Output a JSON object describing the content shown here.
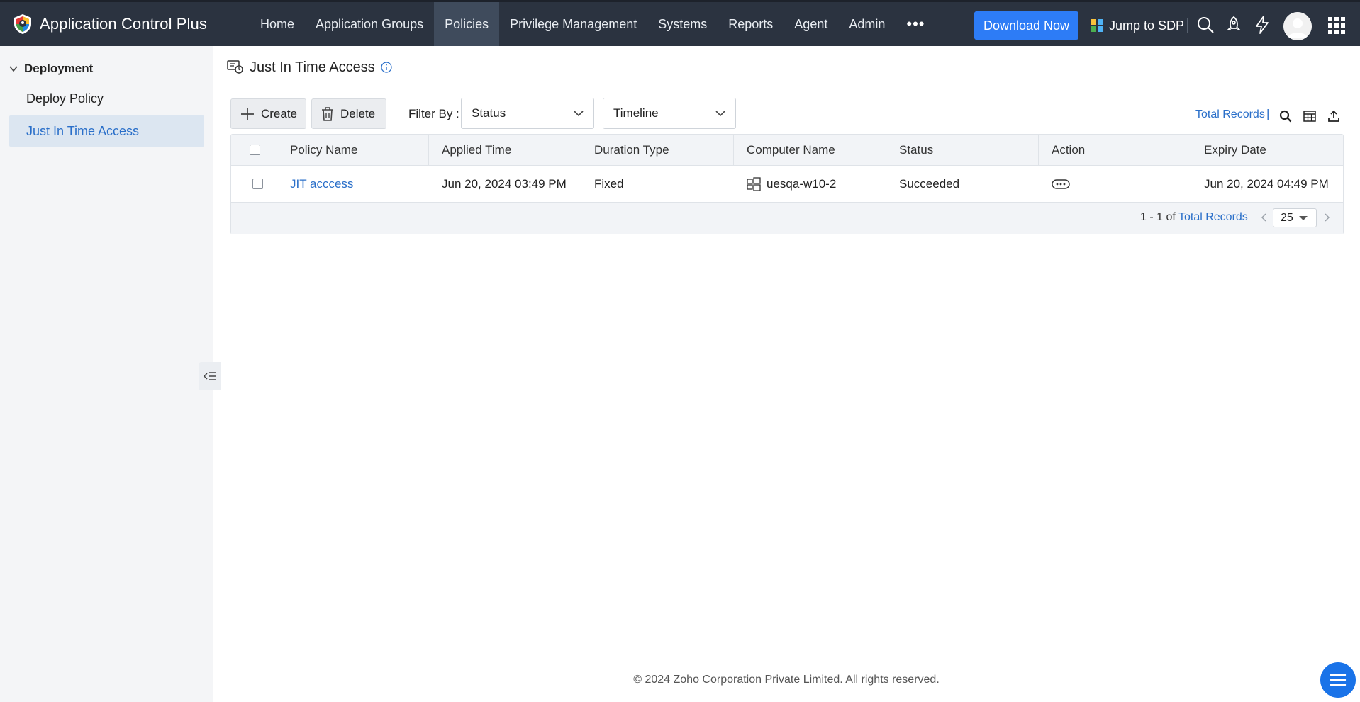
{
  "app": {
    "name": "Application Control Plus"
  },
  "nav": {
    "items": [
      "Home",
      "Application Groups",
      "Policies",
      "Privilege Management",
      "Systems",
      "Reports",
      "Agent",
      "Admin"
    ],
    "active": "Policies",
    "more": "•••"
  },
  "topbar": {
    "download_label": "Download Now",
    "jump_label": "Jump to SDP",
    "icons": [
      "search-icon",
      "rocket-icon",
      "lightning-icon",
      "avatar",
      "apps-grid-icon"
    ]
  },
  "sidebar": {
    "section": "Deployment",
    "items": [
      {
        "label": "Deploy Policy",
        "active": false
      },
      {
        "label": "Just In Time Access",
        "active": true
      }
    ]
  },
  "page": {
    "title": "Just In Time Access"
  },
  "toolbar": {
    "create_label": "Create",
    "delete_label": "Delete",
    "filter_label": "Filter By :",
    "status_select": "Status",
    "timeline_select": "Timeline",
    "total_records": "Total Records",
    "total_bar": "|"
  },
  "table": {
    "columns": [
      "Policy Name",
      "Applied Time",
      "Duration Type",
      "Computer Name",
      "Status",
      "Action",
      "Expiry Date"
    ],
    "rows": [
      {
        "policy_name": "JIT acccess",
        "applied_time": "Jun 20, 2024 03:49 PM",
        "duration_type": "Fixed",
        "computer_name": "uesqa-w10-2",
        "status": "Succeeded",
        "expiry_date": "Jun 20, 2024 04:49 PM"
      }
    ]
  },
  "pagination": {
    "range": "1 - 1 of",
    "total_label": "Total Records",
    "page_size": "25"
  },
  "footer": {
    "copyright": "© 2024 Zoho Corporation Private Limited. All rights reserved."
  },
  "colors": {
    "topbar": "#2b3340",
    "accent": "#2d7cf6",
    "link": "#2a6fc9"
  }
}
